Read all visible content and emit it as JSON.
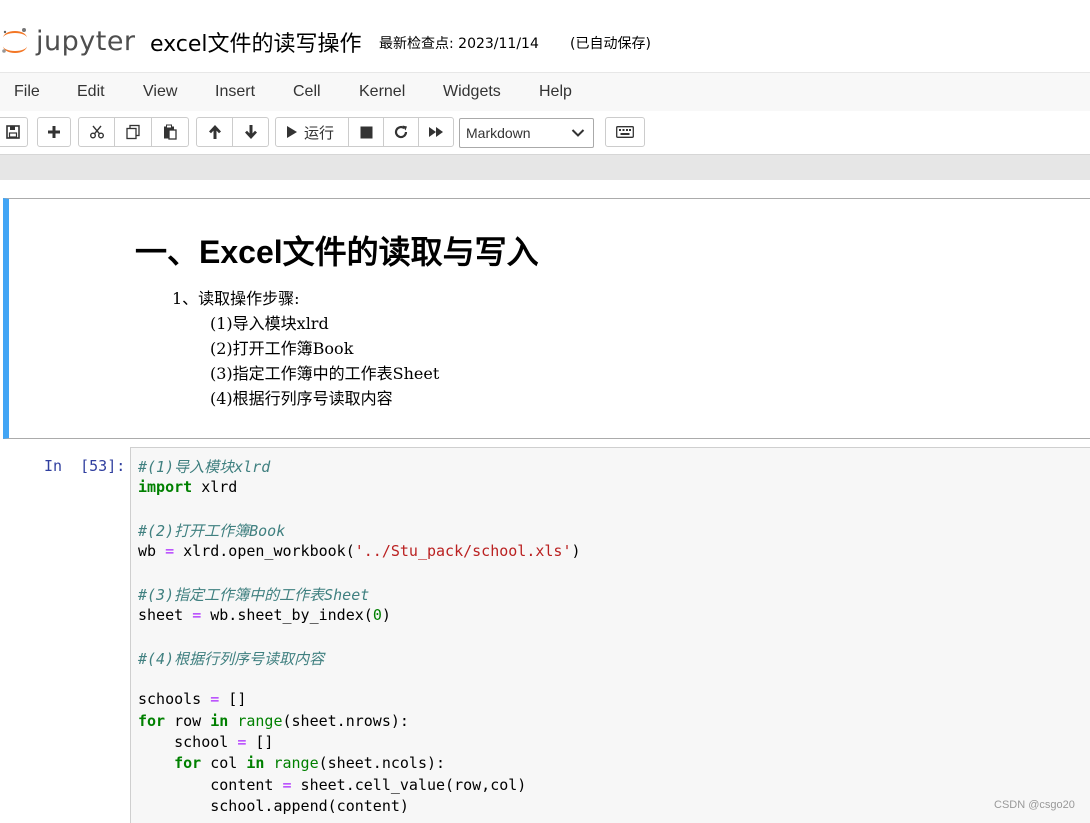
{
  "header": {
    "logo_text": "jupyter",
    "notebook_title": "excel文件的读写操作",
    "checkpoint": "最新检查点: 2023/11/14",
    "autosave": "(已自动保存)"
  },
  "menu": [
    "File",
    "Edit",
    "View",
    "Insert",
    "Cell",
    "Kernel",
    "Widgets",
    "Help"
  ],
  "toolbar": {
    "run_label": "运行",
    "cell_type": "Markdown",
    "icons": [
      "save-icon",
      "plus-icon",
      "cut-icon",
      "copy-icon",
      "paste-icon",
      "arrow-up-icon",
      "arrow-down-icon",
      "run-icon",
      "stop-icon",
      "restart-icon",
      "fast-forward-icon",
      "keyboard-icon"
    ]
  },
  "markdown_cell": {
    "heading": "一、Excel文件的读取与写入",
    "lines": [
      "1、读取操作步骤:",
      "(1)导入模块xlrd",
      "(2)打开工作簿Book",
      "(3)指定工作簿中的工作表Sheet",
      "(4)根据行列序号读取内容"
    ]
  },
  "code_cell": {
    "prompt": "In  [53]:",
    "lines": [
      "#(1)导入模块xlrd",
      "import xlrd",
      "",
      "#(2)打开工作簿Book",
      "wb = xlrd.open_workbook('../Stu_pack/school.xls')",
      "",
      "#(3)指定工作簿中的工作表Sheet",
      "sheet = wb.sheet_by_index(0)",
      "",
      "#(4)根据行列序号读取内容",
      "",
      "schools = []",
      "for row in range(sheet.nrows):",
      "    school = []",
      "    for col in range(sheet.ncols):",
      "        content = sheet.cell_value(row,col)",
      "        school.append(content)"
    ]
  },
  "watermark": "CSDN @csgo20",
  "colors": {
    "cell_selected_bar": "#42a5f5",
    "prompt": "#303f9f",
    "comment": "#408080",
    "keyword": "#008000"
  }
}
